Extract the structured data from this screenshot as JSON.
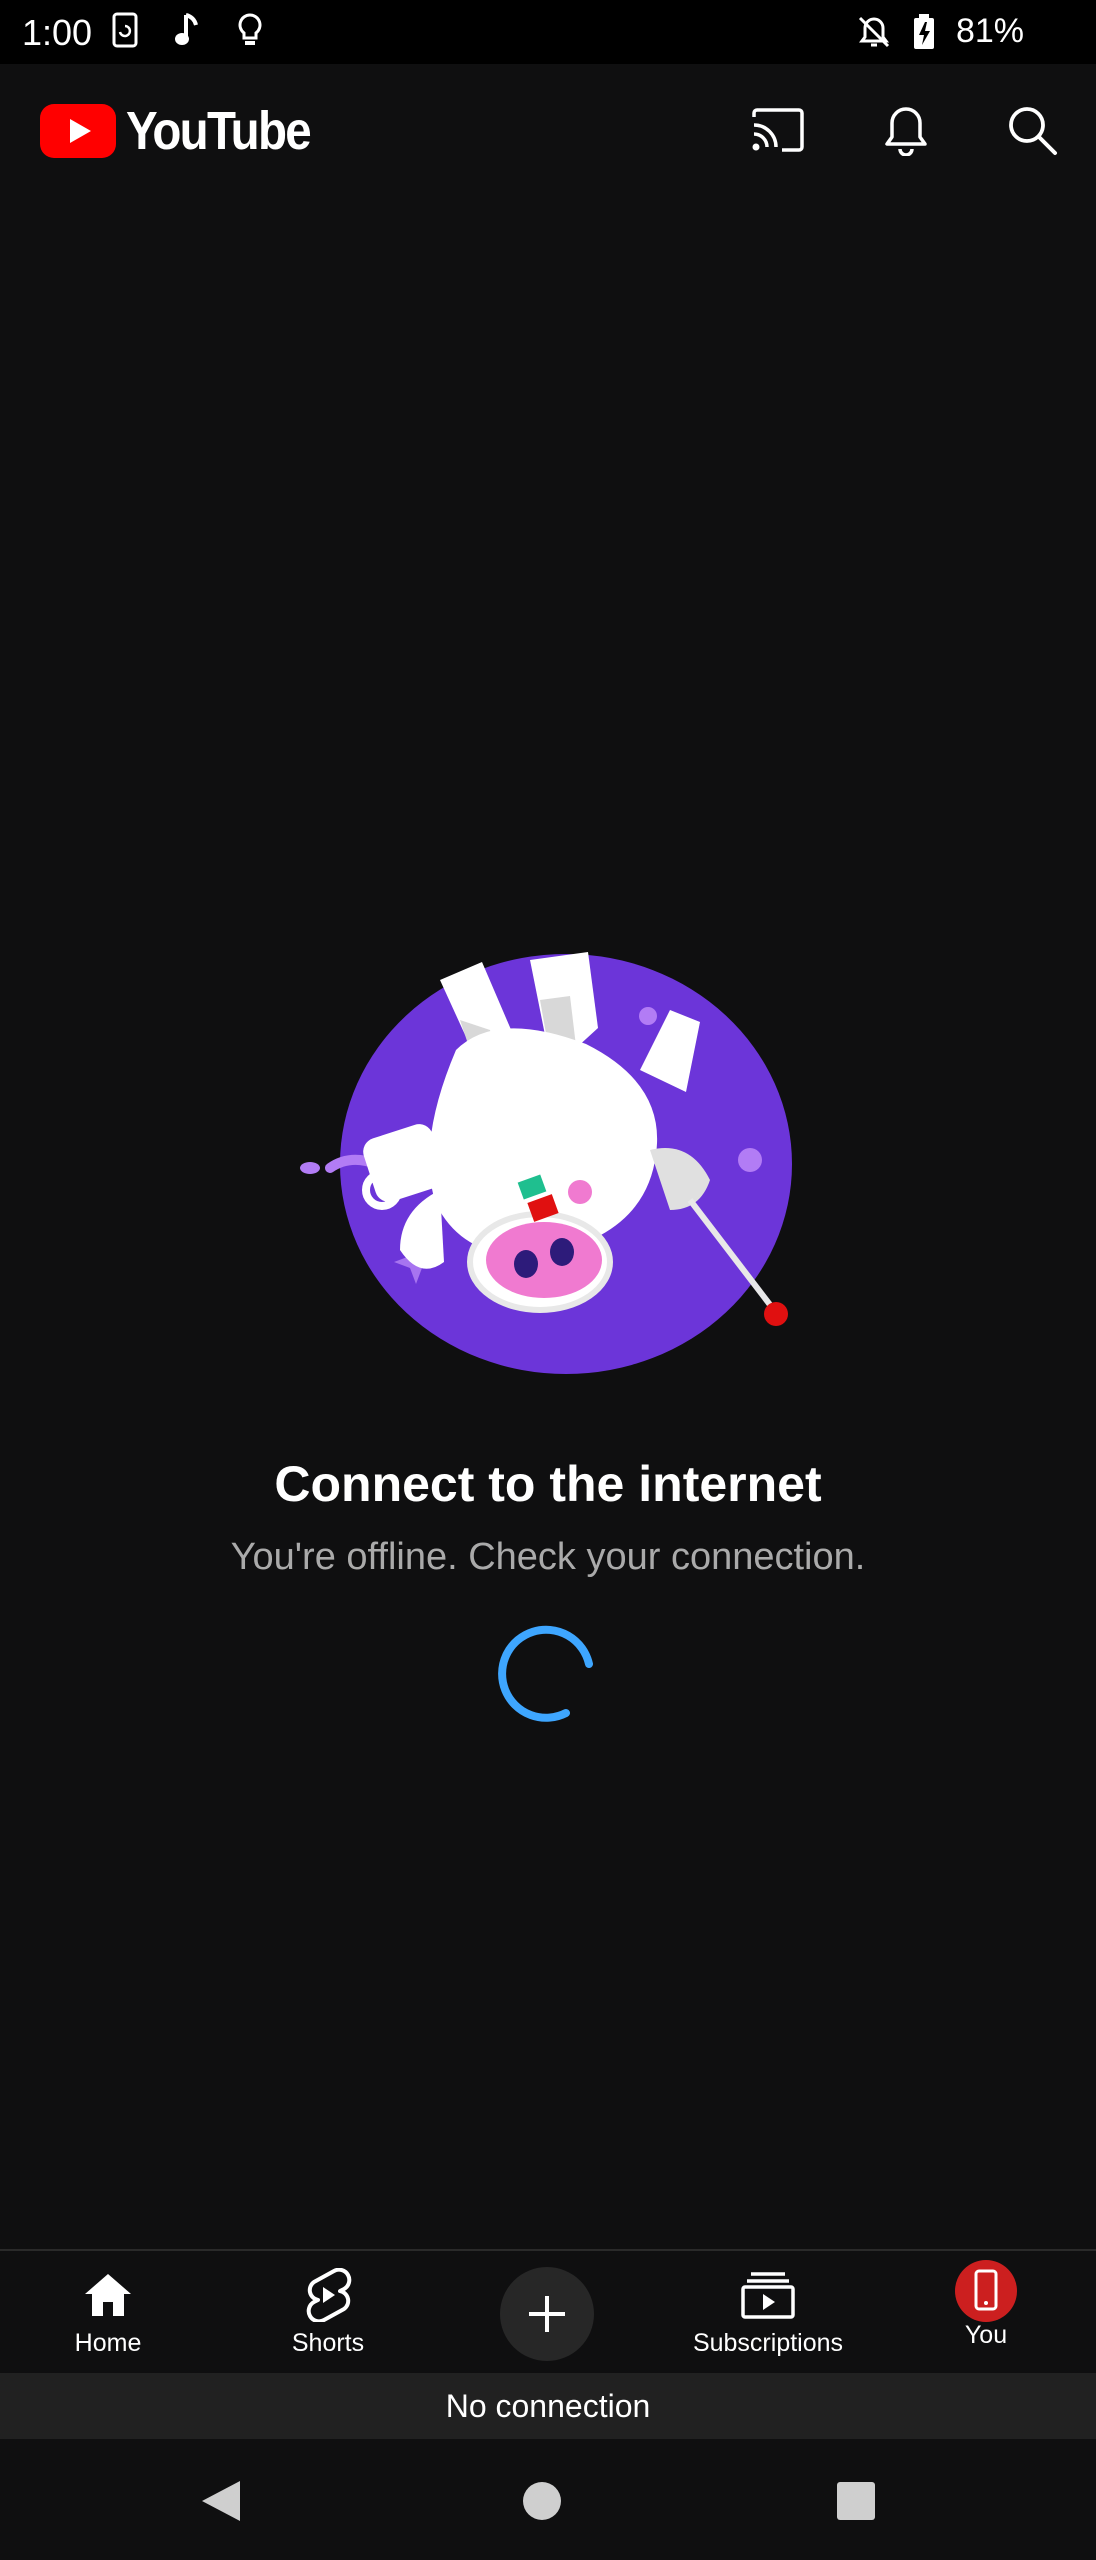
{
  "status_bar": {
    "time": "1:00",
    "battery": "81%",
    "icons": [
      "screenshot-icon",
      "music-note-icon",
      "lightbulb-icon",
      "notifications-off-icon",
      "battery-charging-icon"
    ]
  },
  "app_bar": {
    "logo_text": "YouTube",
    "brand_color": "#ff0000",
    "icons": [
      "cast-icon",
      "notifications-bell-icon",
      "search-icon"
    ]
  },
  "offline": {
    "title": "Connect to the internet",
    "message": "You're offline. Check your connection.",
    "spinner_color": "#3ea6ff"
  },
  "bottom_nav": {
    "items": [
      {
        "label": "Home",
        "icon": "home-icon"
      },
      {
        "label": "Shorts",
        "icon": "shorts-icon"
      },
      {
        "label": "",
        "icon": "create-plus-icon"
      },
      {
        "label": "Subscriptions",
        "icon": "subscriptions-icon"
      },
      {
        "label": "You",
        "icon": "avatar-icon"
      }
    ]
  },
  "connection_banner": {
    "text": "No connection"
  },
  "system_nav": {
    "icons": [
      "back-icon",
      "home-circle-icon",
      "recents-icon"
    ]
  }
}
